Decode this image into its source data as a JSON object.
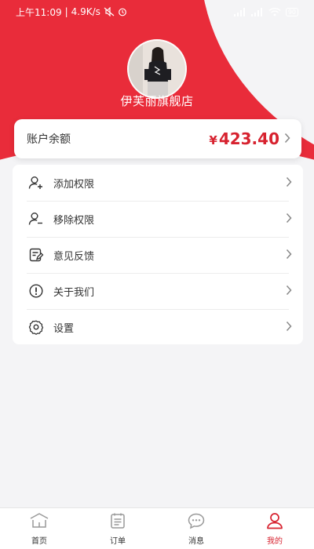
{
  "status_bar": {
    "time": "上午11:09",
    "speed": "4.9K/s",
    "battery": "90"
  },
  "profile": {
    "shop_name": "伊芙丽旗舰店",
    "avatar_icon": "profile-photo"
  },
  "balance": {
    "label": "账户余额",
    "currency": "¥",
    "amount": "423.40"
  },
  "menu": {
    "items": [
      {
        "label": "添加权限",
        "icon": "add-user-icon"
      },
      {
        "label": "移除权限",
        "icon": "remove-user-icon"
      },
      {
        "label": "意见反馈",
        "icon": "feedback-icon"
      },
      {
        "label": "关于我们",
        "icon": "info-icon"
      },
      {
        "label": "设置",
        "icon": "gear-icon"
      }
    ]
  },
  "tabbar": {
    "items": [
      {
        "label": "首页",
        "icon": "home-icon"
      },
      {
        "label": "订单",
        "icon": "orders-icon"
      },
      {
        "label": "消息",
        "icon": "message-icon"
      },
      {
        "label": "我的",
        "icon": "profile-icon",
        "active": true
      }
    ]
  },
  "colors": {
    "brand": "#e92c3a",
    "amount": "#d7222f",
    "active_tab": "#d7222f"
  }
}
